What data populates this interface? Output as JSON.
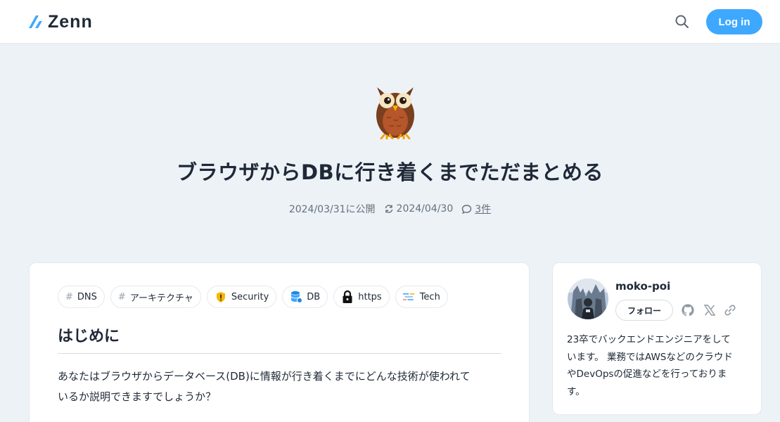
{
  "header": {
    "logo_text": "Zenn",
    "login_label": "Log in",
    "brand_color": "#3ea8ff",
    "search_icon": "search-icon"
  },
  "article": {
    "emoji": "owl",
    "title": "ブラウザからDBに行き着くまでただまとめる",
    "published": "2024/03/31に公開",
    "updated": "2024/04/30",
    "comments": "3件"
  },
  "tags": [
    {
      "label": "DNS",
      "icon": "hash"
    },
    {
      "label": "アーキテクチャ",
      "icon": "hash"
    },
    {
      "label": "Security",
      "icon": "shield-warning-icon"
    },
    {
      "label": "DB",
      "icon": "database-icon"
    },
    {
      "label": "https",
      "icon": "lock-icon"
    },
    {
      "label": "Tech",
      "icon": "tech-lines-icon"
    }
  ],
  "content": {
    "heading": "はじめに",
    "paragraph_line1": "あなたはブラウザからデータベース(DB)に情報が行き着くまでにどんな技術が使われて",
    "paragraph_line2": "いるか説明できますでしょうか？"
  },
  "author": {
    "name": "moko-poi",
    "follow_label": "フォロー",
    "social": [
      "github-icon",
      "x-icon",
      "link-icon"
    ],
    "bio_lines": [
      "23卒でバックエンドエンジニアをして",
      "います。 業務ではAWSなどのクラウド",
      "やDevOpsの促進などを行っておりま",
      "す。"
    ]
  }
}
